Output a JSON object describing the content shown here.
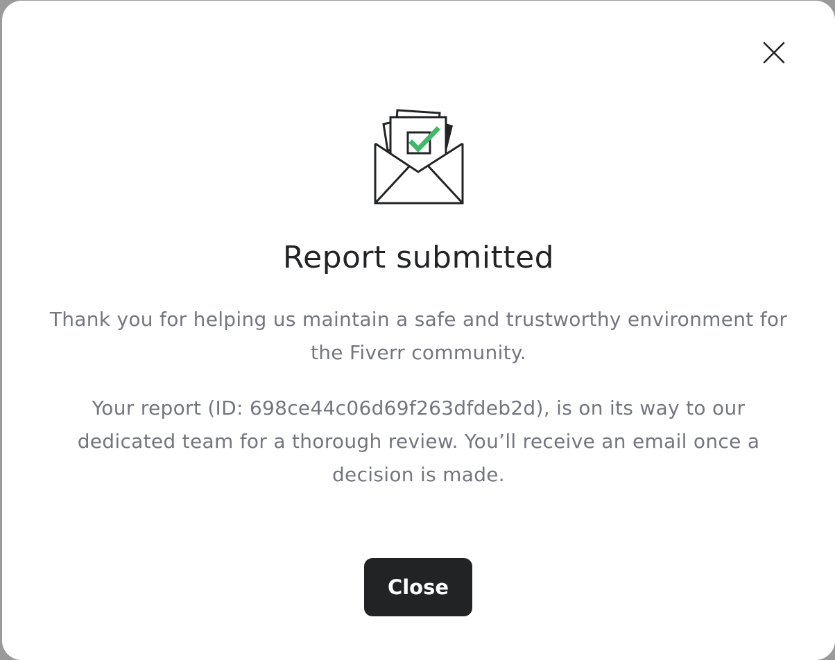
{
  "modal": {
    "title": "Report submitted",
    "paragraph_1": "Thank you for helping us maintain a safe and trustworthy environment for the Fiverr community.",
    "paragraph_2": "Your report (ID: 698ce44c06d69f263dfdeb2d), is on its way to our dedicated team for a thorough review. You’ll receive an email once a decision is made.",
    "close_button_label": "Close",
    "close_icon": "close-icon",
    "illustration_icon": "envelope-check-icon"
  },
  "colors": {
    "title_text": "#222325",
    "body_text": "#74767e",
    "button_bg": "#222325",
    "button_text": "#ffffff",
    "check_green": "#3fb86a",
    "backdrop": "#9a9a9a"
  }
}
